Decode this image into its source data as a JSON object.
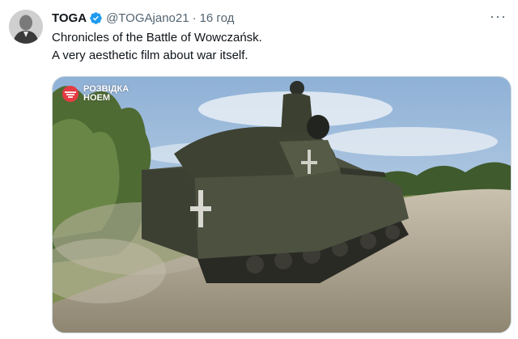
{
  "tweet": {
    "name": "TOGA",
    "handle": "@TOGAjano21",
    "separator": "·",
    "time": "16 год",
    "more": "···",
    "text_lines": [
      "Chronicles of the Battle of Wowczańsk.",
      "A very aesthetic film about war itself."
    ],
    "media": {
      "watermark_line1": "РОЗВІДКА",
      "watermark_line2": "НОЕМ"
    }
  },
  "colors": {
    "text": "#0f1419",
    "muted": "#536471",
    "verified": "#1d9bf0",
    "border": "#cfd9de"
  },
  "icons": {
    "verified": "verified-badge-icon",
    "more": "more-horizontal-icon",
    "watermark": "unit-logo-icon"
  }
}
